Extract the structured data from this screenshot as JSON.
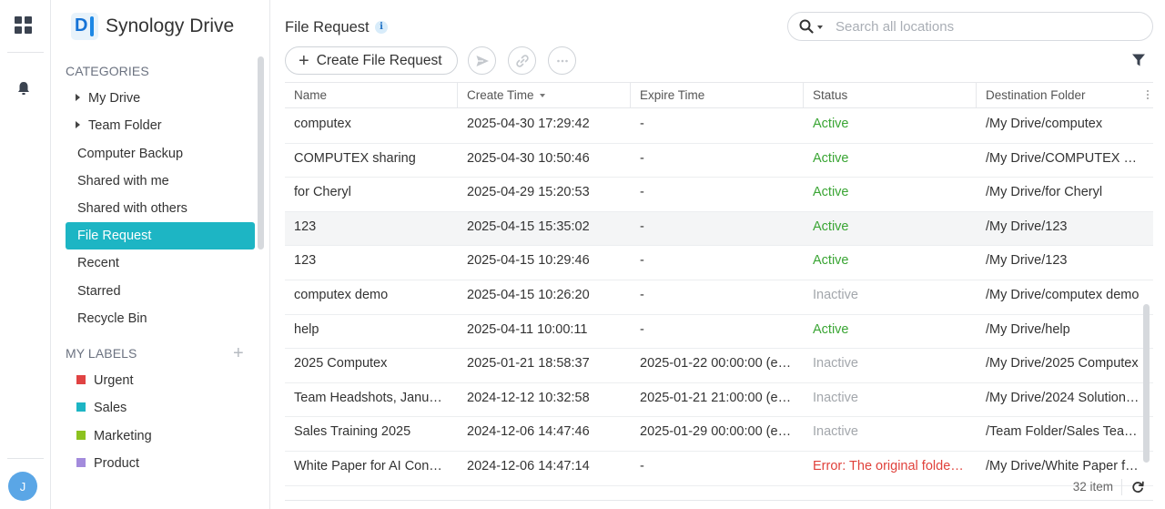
{
  "rail": {
    "avatar_initial": "J"
  },
  "sidebar": {
    "app_title": "Synology Drive",
    "logo_letter": "D",
    "categories_label": "CATEGORIES",
    "items": [
      {
        "label": "My Drive"
      },
      {
        "label": "Team Folder"
      },
      {
        "label": "Computer Backup"
      },
      {
        "label": "Shared with me"
      },
      {
        "label": "Shared with others"
      },
      {
        "label": "File Request"
      },
      {
        "label": "Recent"
      },
      {
        "label": "Starred"
      },
      {
        "label": "Recycle Bin"
      }
    ],
    "labels_heading": "MY LABELS",
    "add_label_symbol": "+",
    "labels": [
      {
        "label": "Urgent",
        "color": "#e04343"
      },
      {
        "label": "Sales",
        "color": "#1db5c4"
      },
      {
        "label": "Marketing",
        "color": "#8cc21f"
      },
      {
        "label": "Product",
        "color": "#a38bdc"
      }
    ],
    "active_color": "#1db5c4"
  },
  "header": {
    "title": "File Request",
    "info_glyph": "i",
    "search_placeholder": "Search all locations"
  },
  "toolbar": {
    "create_label": "Create File Request",
    "plus_glyph": "+"
  },
  "table": {
    "columns": [
      {
        "label": "Name"
      },
      {
        "label": "Create Time"
      },
      {
        "label": "Expire Time"
      },
      {
        "label": "Status"
      },
      {
        "label": "Destination Folder"
      }
    ],
    "rows": [
      {
        "name": "computex",
        "create": "2025-04-30 17:29:42",
        "expire": "-",
        "status": "Active",
        "status_kind": "active",
        "dest": "/My Drive/computex"
      },
      {
        "name": "COMPUTEX sharing",
        "create": "2025-04-30 10:50:46",
        "expire": "-",
        "status": "Active",
        "status_kind": "active",
        "dest": "/My Drive/COMPUTEX …"
      },
      {
        "name": "for Cheryl",
        "create": "2025-04-29 15:20:53",
        "expire": "-",
        "status": "Active",
        "status_kind": "active",
        "dest": "/My Drive/for Cheryl"
      },
      {
        "name": "123",
        "create": "2025-04-15 15:35:02",
        "expire": "-",
        "status": "Active",
        "status_kind": "active",
        "dest": "/My Drive/123"
      },
      {
        "name": "123",
        "create": "2025-04-15 10:29:46",
        "expire": "-",
        "status": "Active",
        "status_kind": "active",
        "dest": "/My Drive/123"
      },
      {
        "name": "computex demo",
        "create": "2025-04-15 10:26:20",
        "expire": "-",
        "status": "Inactive",
        "status_kind": "inactive",
        "dest": "/My Drive/computex demo"
      },
      {
        "name": "help",
        "create": "2025-04-11 10:00:11",
        "expire": "-",
        "status": "Active",
        "status_kind": "active",
        "dest": "/My Drive/help"
      },
      {
        "name": "2025 Computex",
        "create": "2025-01-21 18:58:37",
        "expire": "2025-01-22 00:00:00 (e…",
        "status": "Inactive",
        "status_kind": "inactive",
        "dest": "/My Drive/2025 Computex"
      },
      {
        "name": "Team Headshots, Janu…",
        "create": "2024-12-12 10:32:58",
        "expire": "2025-01-21 21:00:00 (e…",
        "status": "Inactive",
        "status_kind": "inactive",
        "dest": "/My Drive/2024 Solution…"
      },
      {
        "name": "Sales Training 2025",
        "create": "2024-12-06 14:47:46",
        "expire": "2025-01-29 00:00:00 (e…",
        "status": "Inactive",
        "status_kind": "inactive",
        "dest": "/Team Folder/Sales Tea…"
      },
      {
        "name": "White Paper for AI Con…",
        "create": "2024-12-06 14:47:14",
        "expire": "-",
        "status": "Error: The original folde…",
        "status_kind": "error",
        "dest": "/My Drive/White Paper f…"
      }
    ]
  },
  "footer": {
    "count": "32 item"
  }
}
